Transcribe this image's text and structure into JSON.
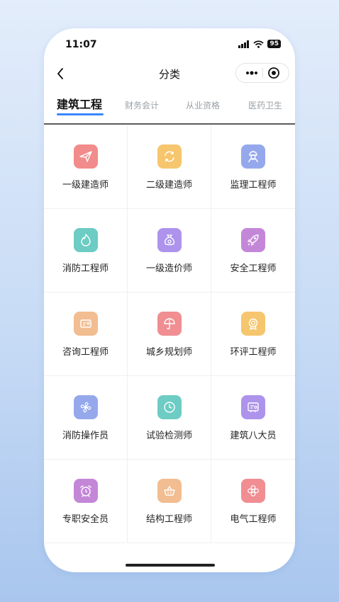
{
  "status_bar": {
    "time": "11:07",
    "battery": "95"
  },
  "nav": {
    "title": "分类"
  },
  "tabs": [
    {
      "label": "建筑工程",
      "active": true
    },
    {
      "label": "财务会计",
      "active": false
    },
    {
      "label": "从业资格",
      "active": false
    },
    {
      "label": "医药卫生",
      "active": false
    }
  ],
  "grid": [
    {
      "label": "一级建造师",
      "icon": "paper-plane-icon",
      "color": "#f28b8b"
    },
    {
      "label": "二级建造师",
      "icon": "refresh-icon",
      "color": "#f6c66e"
    },
    {
      "label": "监理工程师",
      "icon": "engineer-icon",
      "color": "#96a8ec"
    },
    {
      "label": "消防工程师",
      "icon": "flame-icon",
      "color": "#6dccc3"
    },
    {
      "label": "一级造价师",
      "icon": "money-bag-icon",
      "color": "#ad93ec"
    },
    {
      "label": "安全工程师",
      "icon": "rocket-icon",
      "color": "#c487d8"
    },
    {
      "label": "咨询工程师",
      "icon": "id-card-icon",
      "color": "#f2bd91"
    },
    {
      "label": "城乡规划师",
      "icon": "umbrella-icon",
      "color": "#f08e92"
    },
    {
      "label": "环评工程师",
      "icon": "badge-icon",
      "color": "#f6c66e"
    },
    {
      "label": "消防操作员",
      "icon": "fan-icon",
      "color": "#96a8ec"
    },
    {
      "label": "试验检测师",
      "icon": "clock-icon",
      "color": "#6dccc3"
    },
    {
      "label": "建筑八大员",
      "icon": "certificate-icon",
      "color": "#ad93ec"
    },
    {
      "label": "专职安全员",
      "icon": "alarm-clock-icon",
      "color": "#c487d8"
    },
    {
      "label": "结构工程师",
      "icon": "basket-icon",
      "color": "#f2bd91"
    },
    {
      "label": "电气工程师",
      "icon": "flower-icon",
      "color": "#f08e92"
    }
  ]
}
